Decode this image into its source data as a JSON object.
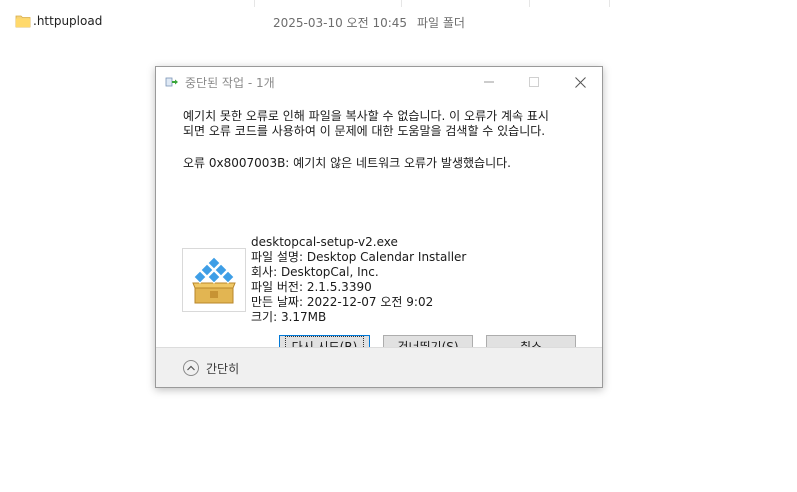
{
  "explorer": {
    "file_name": ".httpupload",
    "modified": "2025-03-10 오전 10:45",
    "type": "파일 폴더"
  },
  "dialog": {
    "title": "중단된 작업 - 1개",
    "message_line1": "예기치 못한 오류로 인해 파일을 복사할 수 없습니다. 이 오류가 계속 표시",
    "message_line2": "되면 오류 코드를 사용하여 이 문제에 대한 도움말을 검색할 수 있습니다.",
    "error": "오류 0x8007003B: 예기치 않은 네트워크 오류가 발생했습니다.",
    "file": {
      "name": "desktopcal-setup-v2.exe",
      "description": "파일 설명: Desktop Calendar Installer",
      "company": "회사: DesktopCal, Inc.",
      "version": "파일 버전: 2.1.5.3390",
      "created": "만든 날짜: 2022-12-07 오전 9:02",
      "size": "크기: 3.17MB"
    },
    "buttons": {
      "retry": "다시 시도(R)",
      "skip": "건너뛰기(S)",
      "cancel": "취소"
    },
    "footer_label": "간단히"
  },
  "colors": {
    "dialog_bg": "#f0f0f0",
    "focus_border": "#0078d7"
  }
}
